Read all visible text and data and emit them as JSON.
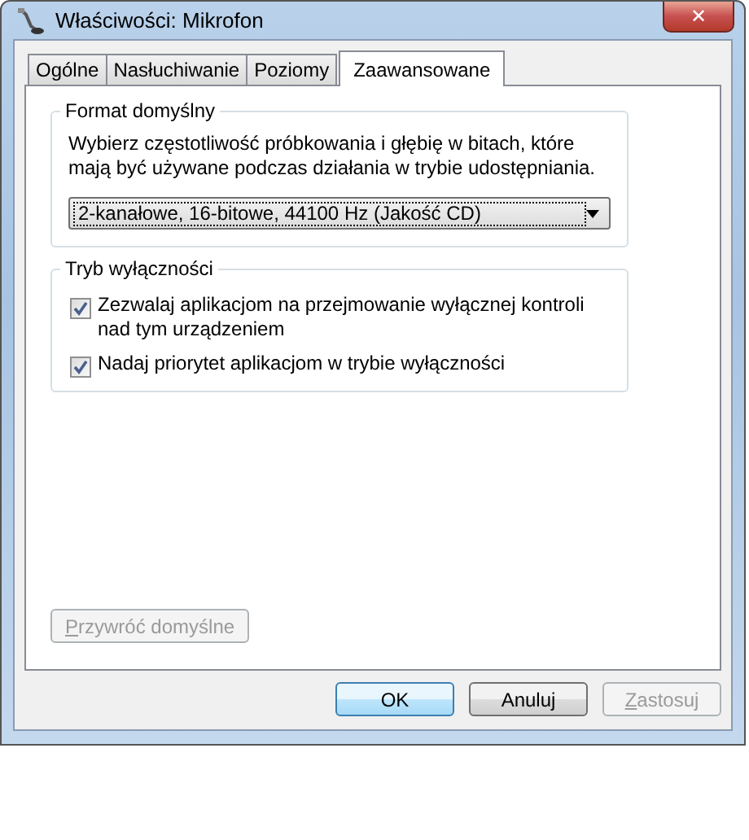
{
  "window": {
    "title": "Właściwości: Mikrofon",
    "close": "✕"
  },
  "tabs": [
    {
      "label": "Ogólne",
      "selected": false
    },
    {
      "label": "Nasłuchiwanie",
      "selected": false
    },
    {
      "label": "Poziomy",
      "selected": false
    },
    {
      "label": "Zaawansowane",
      "selected": true
    }
  ],
  "format_group": {
    "title": "Format domyślny",
    "description": "Wybierz częstotliwość próbkowania i głębię w bitach, które mają być używane podczas działania w trybie udostępniania.",
    "dropdown": {
      "value": "2-kanałowe, 16-bitowe, 44100 Hz (Jakość CD)"
    }
  },
  "exclusive_group": {
    "title": "Tryb wyłączności",
    "checkboxes": [
      {
        "label": "Zezwalaj aplikacjom na przejmowanie wyłącznej kontroli nad tym urządzeniem",
        "checked": true
      },
      {
        "label": "Nadaj priorytet aplikacjom w trybie wyłączności",
        "checked": true
      }
    ]
  },
  "restore_button": {
    "label": "Przywróć domyślne",
    "disabled": true,
    "mnemonic": true
  },
  "buttons": [
    {
      "label": "OK",
      "disabled": false,
      "default": true,
      "mnemonic": false
    },
    {
      "label": "Anuluj",
      "disabled": false,
      "default": false,
      "mnemonic": false
    },
    {
      "label": "Zastosuj",
      "disabled": true,
      "default": false,
      "mnemonic": true
    }
  ]
}
